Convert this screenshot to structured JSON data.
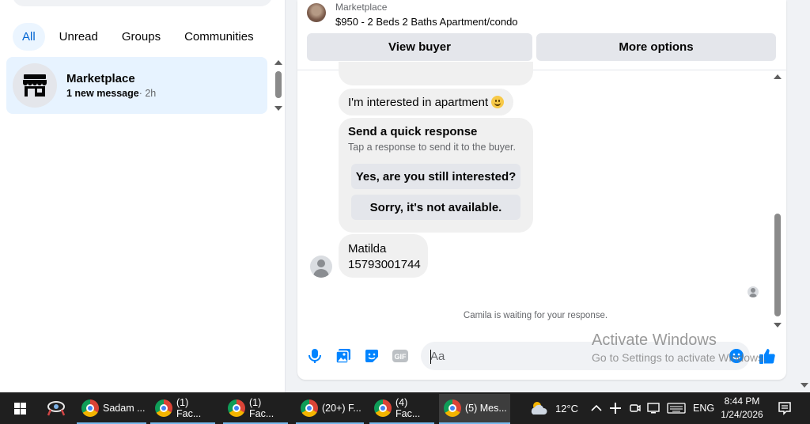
{
  "sidebar": {
    "filters": [
      "All",
      "Unread",
      "Groups",
      "Communities"
    ],
    "active_filter": "All",
    "conversation": {
      "title": "Marketplace",
      "new_message": "1 new message",
      "time": "· 2h"
    }
  },
  "chat": {
    "listing": {
      "source": "Marketplace",
      "title": "$950 - 2 Beds 2 Baths Apartment/condo"
    },
    "buttons": {
      "view_buyer": "View buyer",
      "more_options": "More options"
    },
    "messages": {
      "interest": "I'm interested in apartment",
      "quick_title": "Send a quick response",
      "quick_subtitle": "Tap a response to send it to the buyer.",
      "quick_reply_1": "Yes, are you still interested?",
      "quick_reply_2": "Sorry, it's not available.",
      "contact_name": "Matilda",
      "contact_number": "15793001744"
    },
    "waiting_text": "Camila is waiting for your response.",
    "composer": {
      "placeholder": "Aa"
    }
  },
  "watermark": {
    "line1": "Activate Windows",
    "line2": "Go to Settings to activate Windows."
  },
  "taskbar": {
    "apps": [
      {
        "label": "Sadam ...",
        "icon": "chrome-icon"
      },
      {
        "label": "(1) Fac...",
        "icon": "chrome-icon"
      },
      {
        "label": "(1) Fac...",
        "icon": "chrome-icon"
      },
      {
        "label": "(20+) F...",
        "icon": "chrome-icon"
      },
      {
        "label": "(4) Fac...",
        "icon": "chrome-icon"
      },
      {
        "label": "(5) Mes...",
        "icon": "chrome-icon"
      }
    ],
    "weather": "12°C",
    "language": "ENG",
    "time": "8:44 PM",
    "date": "1/24/2026"
  },
  "colors": {
    "accent": "#0064d1",
    "messenger_blue": "#0084ff",
    "selected_bg": "#e7f3ff",
    "taskbar": "#1f1f1f"
  }
}
